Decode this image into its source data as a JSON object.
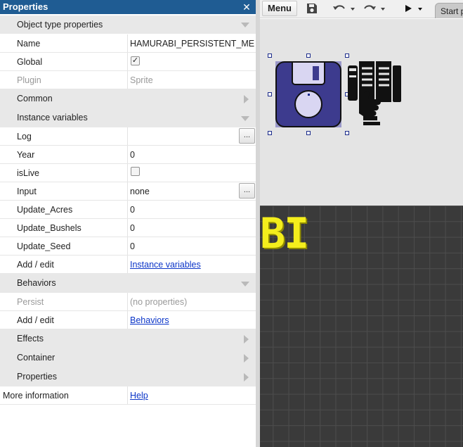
{
  "panel": {
    "title": "Properties",
    "close_glyph": "✕"
  },
  "sections": {
    "object_type": "Object type properties",
    "common": "Common",
    "instance_variables": "Instance variables",
    "behaviors": "Behaviors",
    "effects": "Effects",
    "container": "Container",
    "properties": "Properties"
  },
  "object_props": [
    {
      "name": "Name",
      "value": "HAMURABI_PERSISTENT_MEMORY"
    },
    {
      "name": "Global",
      "checked": true
    },
    {
      "name": "Plugin",
      "value": "Sprite"
    }
  ],
  "instance_vars": [
    {
      "name": "Log",
      "value": "",
      "has_button": true
    },
    {
      "name": "Year",
      "value": "0"
    },
    {
      "name": "isLive",
      "checked": false
    },
    {
      "name": "Input",
      "value": "none",
      "has_button": true
    },
    {
      "name": "Update_Acres",
      "value": "0"
    },
    {
      "name": "Update_Bushels",
      "value": "0"
    },
    {
      "name": "Update_Seed",
      "value": "0"
    },
    {
      "name": "Add / edit",
      "link": "Instance variables"
    }
  ],
  "behavior_props": [
    {
      "name": "Persist",
      "value": "(no properties)"
    },
    {
      "name": "Add / edit",
      "link": "Behaviors"
    }
  ],
  "more_info": {
    "name": "More information",
    "link": "Help"
  },
  "ellipsis_label": "...",
  "toolbar": {
    "menu_label": "Menu",
    "start_tab": "Start page"
  },
  "canvas": {
    "title_fragment": "BI"
  },
  "icons": {
    "save": "save-icon",
    "undo": "undo-icon",
    "redo": "redo-icon",
    "run": "play-icon"
  },
  "colors": {
    "panel_title_bg": "#1f5c93",
    "section_bg": "#e8e8e8",
    "link": "#0b35c8",
    "layout_bg": "#3a3a3a",
    "title_text": "#f4ee1c",
    "disk_fill": "#3d3b8e"
  }
}
